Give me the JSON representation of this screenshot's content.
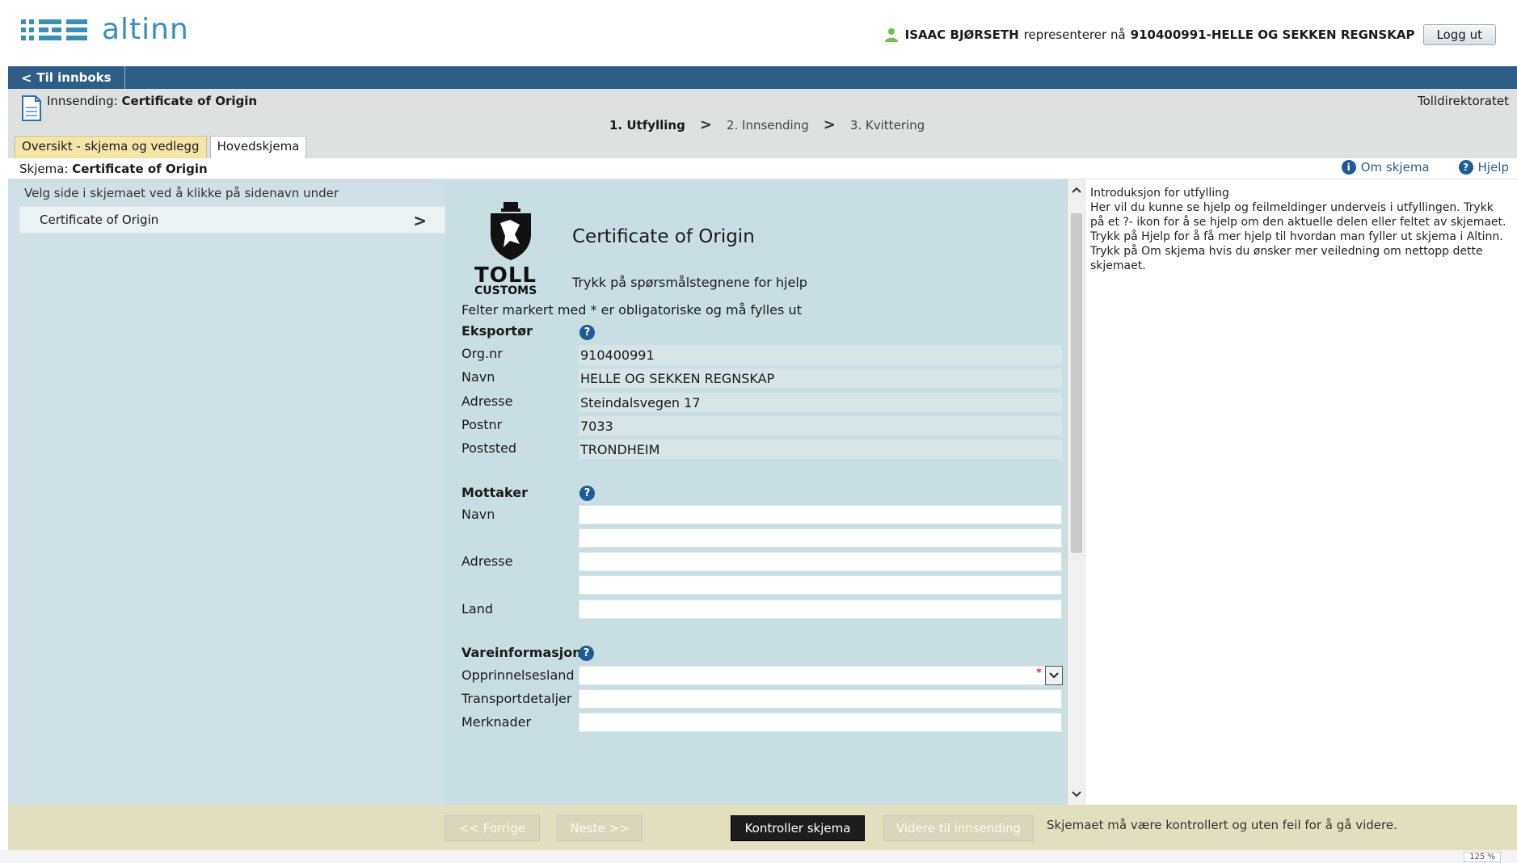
{
  "header": {
    "logo_text": "altinn",
    "user_name": "ISAAC BJØRSETH",
    "represents_text": "representerer nå",
    "org": "910400991-HELLE OG SEKKEN REGNSKAP",
    "logout_label": "Logg ut"
  },
  "nav": {
    "inbox_label": "Til innboks"
  },
  "subheader": {
    "submission_prefix": "Innsending:",
    "submission_name": "Certificate of Origin",
    "agency": "Tolldirektoratet",
    "steps": [
      "1. Utfylling",
      "2. Innsending",
      "3. Kvittering"
    ],
    "tabs": [
      "Oversikt - skjema og vedlegg",
      "Hovedskjema"
    ]
  },
  "schema_bar": {
    "prefix": "Skjema:",
    "name": "Certificate of Origin",
    "about_label": "Om skjema",
    "help_label": "Hjelp"
  },
  "left_panel": {
    "hint": "Velg side i skjemaet ved å klikke på sidenavn under",
    "items": [
      "Certificate of Origin"
    ]
  },
  "form": {
    "logo_toll": "TOLL",
    "logo_customs": "CUSTOMS",
    "title": "Certificate of Origin",
    "help_hint": "Trykk på spørsmålstegnene for hjelp",
    "required_note": "Felter markert med * er obligatoriske og må fylles ut",
    "exporter": {
      "title": "Eksportør",
      "orgnr_label": "Org.nr",
      "orgnr": "910400991",
      "name_label": "Navn",
      "name": "HELLE OG SEKKEN REGNSKAP",
      "address_label": "Adresse",
      "address": "Steindalsvegen 17",
      "postnr_label": "Postnr",
      "postnr": "7033",
      "poststed_label": "Poststed",
      "poststed": "TRONDHEIM"
    },
    "receiver": {
      "title": "Mottaker",
      "name_label": "Navn",
      "address_label": "Adresse",
      "country_label": "Land"
    },
    "goods": {
      "title": "Vareinformasjon",
      "origin_label": "Opprinnelsesland",
      "transport_label": "Transportdetaljer",
      "notes_label": "Merknader",
      "required_mark": "*"
    }
  },
  "help_panel": {
    "title": "Introduksjon for utfylling",
    "body": "Her vil du kunne se hjelp og feilmeldinger underveis i utfyllingen. Trykk på et ?- ikon for å se hjelp om den aktuelle delen eller feltet av skjemaet. Trykk på Hjelp for å få mer hjelp til hvordan man fyller ut skjema i Altinn. Trykk på Om skjema hvis du ønsker mer veiledning om nettopp dette skjemaet."
  },
  "footer": {
    "prev_label": "<< Forrige",
    "next_label": "Neste >>",
    "check_label": "Kontroller skjema",
    "proceed_label": "Videre til innsending",
    "note": "Skjemaet må være kontrollert og uten feil for å gå videre.",
    "zoom": "125 %"
  },
  "colors": {
    "nav_blue": "#2d5e87",
    "brand": "#3a8fb7",
    "form_bg": "#c9dee3",
    "left_bg": "#cfe0e6",
    "footer_bg": "#e2dfbf",
    "active_tab": "#f5e6a8"
  }
}
